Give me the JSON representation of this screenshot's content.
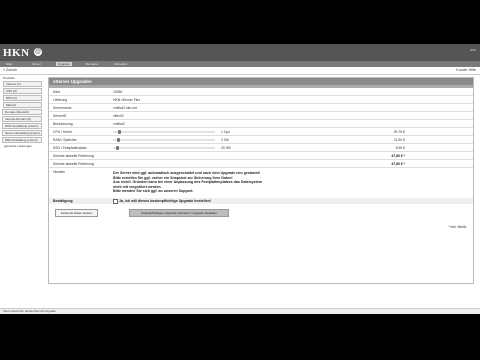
{
  "header": {
    "logo": "HKN",
    "logo_mark": "@",
    "links": "Hilfe"
  },
  "nav": {
    "items": [
      "Start",
      "Server",
      "Upgrade",
      "Domains",
      "Abmelden"
    ],
    "active_index": 2
  },
  "subbar": {
    "back": "« Zurück",
    "user": "Kunde: Hilfe"
  },
  "sidebar": {
    "heading": "Produkte",
    "items": [
      "vServer (1)",
      "CSS (2)",
      "DNS (2)",
      "Mail (2)",
      "Domain-Übersicht",
      "Internet-Domain (0)",
      "DNS-Verwaltung (extern)",
      "Server-Verwaltung (intern)",
      "Mail-Verwaltung (extern)",
      "gebuchte Leistungen"
    ]
  },
  "panel": {
    "title": "vServer Upgraden",
    "rows": [
      {
        "label": "Kdnr.",
        "value": "19050"
      },
      {
        "label": "Lieferung",
        "value": "HKN vServer Flex"
      },
      {
        "label": "Servername",
        "value": "vm5sd2.hkn.net"
      },
      {
        "label": "ServerID",
        "value": "vflex02"
      },
      {
        "label": "Bezeichnung",
        "value": "vm5sd2"
      }
    ],
    "resources": [
      {
        "label": "CPU / Kerne",
        "mid": "1 Cpu",
        "amount": "29,75 €",
        "fill": 0.05
      },
      {
        "label": "RAM / Speicher",
        "mid": "2 GB",
        "amount": "11,90 €",
        "fill": 0.04
      },
      {
        "label": "SSD / Festplattenplatz",
        "mid": "20 GB",
        "amount": "5,95 €",
        "fill": 0.03
      }
    ],
    "totals": [
      {
        "label": "Summe aktuelle Rechnung",
        "amount": "47,60 € *"
      },
      {
        "label": "Summe aktuelle Rechnung",
        "amount": "47,60 € *"
      }
    ],
    "hinweis_label": "Hinweis",
    "hinweis_lines": [
      "Der Server wird ggf. automatisch ausgeschaltet und nach dem Upgrade neu gestartet!",
      "Bitte erstellen Sie ggf. vorher ein Snapshot zur Sicherung Ihrer Daten!",
      "Aus rechtl. Gründen kann bei einer Anpassung des Festplattenplatzes das Dateisystem",
      "nicht mit vergrößert werden.",
      "Bitte wenden Sie sich ggf. an unseren Support."
    ],
    "confirm_label": "Bestätigung",
    "confirm_text": "Ja, ich will dieses kostenpflichtige Upgrade bestellen!",
    "buttons": {
      "back": "Fehlende Daten ändern",
      "submit": "Kostenpflichtiges Upgrade anfordern / Upgrade bestellen"
    },
    "footnote": "* inkl. MwSt."
  },
  "statusbar": {
    "url": "https://www.hkn.de/de/vServer/Upgrade"
  },
  "colors": {
    "header": "#555555",
    "nav": "#7a7a7a",
    "panel_title": "#8a8a8a"
  }
}
